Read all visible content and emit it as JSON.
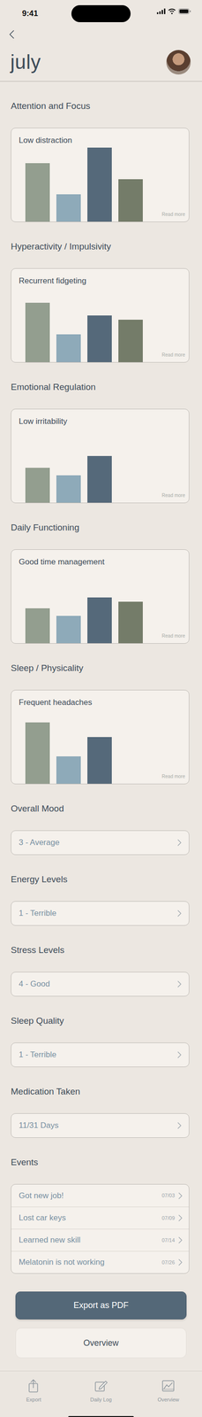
{
  "status_bar": {
    "time": "9:41"
  },
  "header": {
    "title": "july"
  },
  "chart_sections": [
    {
      "heading": "Attention and Focus",
      "card_title": "Low distraction",
      "values": [
        69,
        32,
        87,
        50
      ],
      "link": "Read more"
    },
    {
      "heading": "Hyperactivity / Impulsivity",
      "card_title": "Recurrent fidgeting",
      "values": [
        70,
        33,
        55,
        50
      ],
      "link": "Read more"
    },
    {
      "heading": "Emotional Regulation",
      "card_title": "Low irritability",
      "values": [
        41,
        32,
        55
      ],
      "link": "Read more"
    },
    {
      "heading": "Daily Functioning",
      "card_title": "Good time management",
      "values": [
        41,
        32,
        54,
        49
      ],
      "link": "Read more"
    },
    {
      "heading": "Sleep / Physicality",
      "card_title": "Frequent headaches",
      "values": [
        72,
        32,
        55
      ],
      "link": "Read more"
    }
  ],
  "rating_sections": [
    {
      "heading": "Overall Mood",
      "value": "3 - Average"
    },
    {
      "heading": "Energy Levels",
      "value": "1 - Terrible"
    },
    {
      "heading": "Stress Levels",
      "value": "4 - Good"
    },
    {
      "heading": "Sleep Quality",
      "value": "1 - Terrible"
    },
    {
      "heading": "Medication Taken",
      "value": "11/31 Days"
    }
  ],
  "events": {
    "heading": "Events",
    "items": [
      {
        "title": "Got new job!",
        "date": "07/03"
      },
      {
        "title": "Lost car keys",
        "date": "07/09"
      },
      {
        "title": "Learned new skill",
        "date": "07/14"
      },
      {
        "title": "Melatonin is not working",
        "date": "07/26"
      }
    ]
  },
  "buttons": [
    "Export as PDF",
    "Overview"
  ],
  "tab_bar": [
    {
      "label": "Export",
      "selected": false
    },
    {
      "label": "Daily Log",
      "selected": false
    },
    {
      "label": "Overview",
      "selected": false
    }
  ]
}
